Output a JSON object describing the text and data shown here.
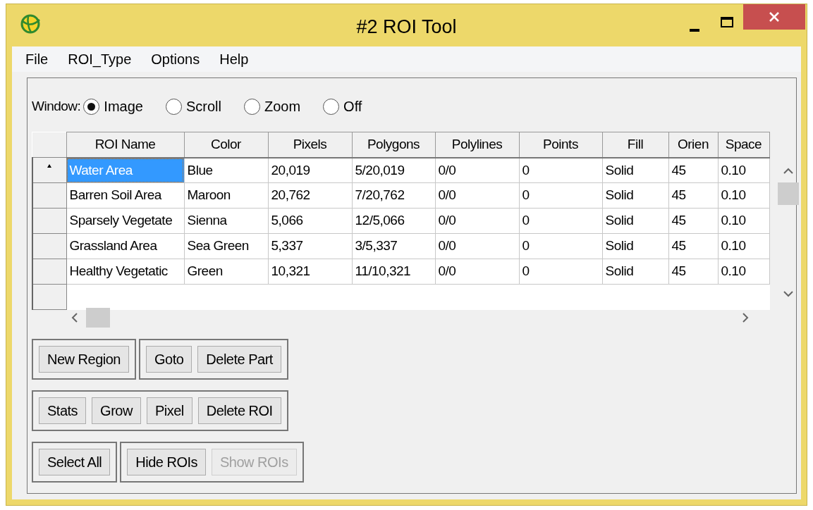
{
  "window": {
    "title": "#2 ROI Tool"
  },
  "menu": [
    "File",
    "ROI_Type",
    "Options",
    "Help"
  ],
  "window_mode": {
    "label": "Window:",
    "options": [
      {
        "label": "Image",
        "selected": true
      },
      {
        "label": "Scroll",
        "selected": false
      },
      {
        "label": "Zoom",
        "selected": false
      },
      {
        "label": "Off",
        "selected": false
      }
    ]
  },
  "table": {
    "columns": [
      "ROI Name",
      "Color",
      "Pixels",
      "Polygons",
      "Polylines",
      "Points",
      "Fill",
      "Orien",
      "Space"
    ],
    "rows": [
      {
        "current": true,
        "selected": true,
        "cells": [
          "Water Area",
          "Blue",
          "20,019",
          "5/20,019",
          "0/0",
          "0",
          "Solid",
          "45",
          "0.10"
        ]
      },
      {
        "current": false,
        "selected": false,
        "cells": [
          "Barren Soil Area",
          "Maroon",
          "20,762",
          "7/20,762",
          "0/0",
          "0",
          "Solid",
          "45",
          "0.10"
        ]
      },
      {
        "current": false,
        "selected": false,
        "cells": [
          "Sparsely Vegetate",
          "Sienna",
          "5,066",
          "12/5,066",
          "0/0",
          "0",
          "Solid",
          "45",
          "0.10"
        ]
      },
      {
        "current": false,
        "selected": false,
        "cells": [
          "Grassland Area",
          "Sea Green",
          "5,337",
          "3/5,337",
          "0/0",
          "0",
          "Solid",
          "45",
          "0.10"
        ]
      },
      {
        "current": false,
        "selected": false,
        "cells": [
          "Healthy Vegetatic",
          "Green",
          "10,321",
          "11/10,321",
          "0/0",
          "0",
          "Solid",
          "45",
          "0.10"
        ]
      }
    ]
  },
  "button_rows": [
    [
      [
        {
          "label": "New Region",
          "disabled": false
        }
      ],
      [
        {
          "label": "Goto",
          "disabled": false
        },
        {
          "label": "Delete Part",
          "disabled": false
        }
      ]
    ],
    [
      [
        {
          "label": "Stats",
          "disabled": false
        },
        {
          "label": "Grow",
          "disabled": false
        },
        {
          "label": "Pixel",
          "disabled": false
        },
        {
          "label": "Delete ROI",
          "disabled": false
        }
      ]
    ],
    [
      [
        {
          "label": "Select All",
          "disabled": false
        }
      ],
      [
        {
          "label": "Hide ROIs",
          "disabled": false
        },
        {
          "label": "Show ROIs",
          "disabled": true
        }
      ]
    ]
  ]
}
